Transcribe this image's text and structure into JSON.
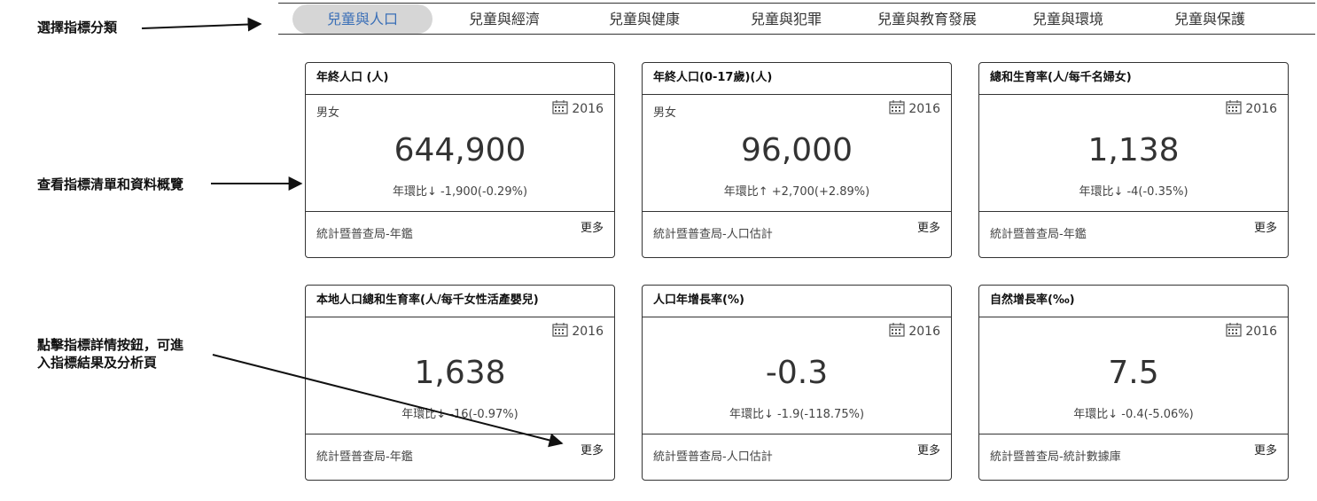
{
  "tabs": [
    {
      "label": "兒童與人口",
      "active": true
    },
    {
      "label": "兒童與經濟",
      "active": false
    },
    {
      "label": "兒童與健康",
      "active": false
    },
    {
      "label": "兒童與犯罪",
      "active": false
    },
    {
      "label": "兒童與教育發展",
      "active": false
    },
    {
      "label": "兒童與環境",
      "active": false
    },
    {
      "label": "兒童與保護",
      "active": false
    }
  ],
  "annotations": {
    "select_category": "選擇指標分類",
    "view_list": "查看指標清單和資料概覽",
    "click_detail_line1": "點擊指標詳情按鈕，可進",
    "click_detail_line2": "入指標結果及分析頁"
  },
  "cards": [
    {
      "title": "年終人口 (人)",
      "gender": "男女",
      "year": "2016",
      "value": "644,900",
      "change": "年環比↓ -1,900(-0.29%)",
      "source": "統計暨普查局-年鑑",
      "more": "更多"
    },
    {
      "title": "年終人口(0-17歲)(人)",
      "gender": "男女",
      "year": "2016",
      "value": "96,000",
      "change": "年環比↑ +2,700(+2.89%)",
      "source": "統計暨普查局-人口估計",
      "more": "更多"
    },
    {
      "title": "總和生育率(人/每千名婦女)",
      "gender": "",
      "year": "2016",
      "value": "1,138",
      "change": "年環比↓ -4(-0.35%)",
      "source": "統計暨普查局-年鑑",
      "more": "更多"
    },
    {
      "title": "本地人口總和生育率(人/每千女性活產嬰兒)",
      "gender": "",
      "year": "2016",
      "value": "1,638",
      "change": "年環比↓ -16(-0.97%)",
      "source": "統計暨普查局-年鑑",
      "more": "更多"
    },
    {
      "title": "人口年增長率(%)",
      "gender": "",
      "year": "2016",
      "value": "-0.3",
      "change": "年環比↓ -1.9(-118.75%)",
      "source": "統計暨普查局-人口估計",
      "more": "更多"
    },
    {
      "title": "自然增長率(‰)",
      "gender": "",
      "year": "2016",
      "value": "7.5",
      "change": "年環比↓ -0.4(-5.06%)",
      "source": "統計暨普查局-統計數據庫",
      "more": "更多"
    }
  ]
}
